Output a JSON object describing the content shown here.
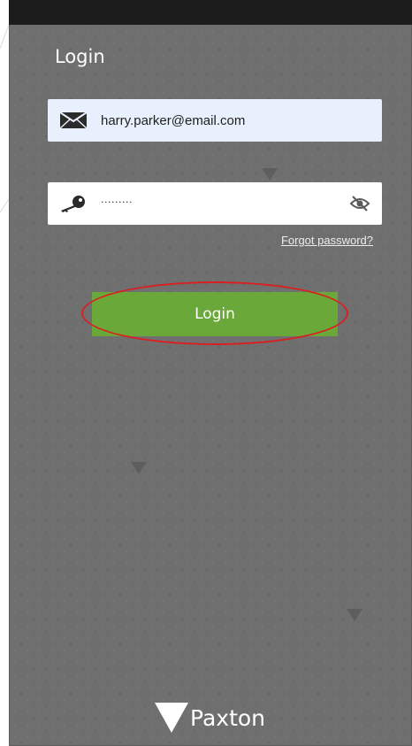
{
  "screen": {
    "title": "Login"
  },
  "login_form": {
    "email": {
      "value": "harry.parker@email.com",
      "icon": "envelope-icon"
    },
    "password": {
      "masked_value": "·········",
      "icon": "key-icon",
      "toggle_icon": "eye-slash-icon"
    },
    "forgot_password_label": "Forgot password?",
    "submit_label": "Login"
  },
  "brand": {
    "name": "Paxton",
    "mark_icon": "paxton-triangle-logo"
  },
  "colors": {
    "screen_background": "#6f6f6f",
    "status_bar": "#1c1c1c",
    "button_green": "#6aa83a",
    "email_field_bg": "#e8f0fe",
    "highlight_red": "#d92020"
  }
}
